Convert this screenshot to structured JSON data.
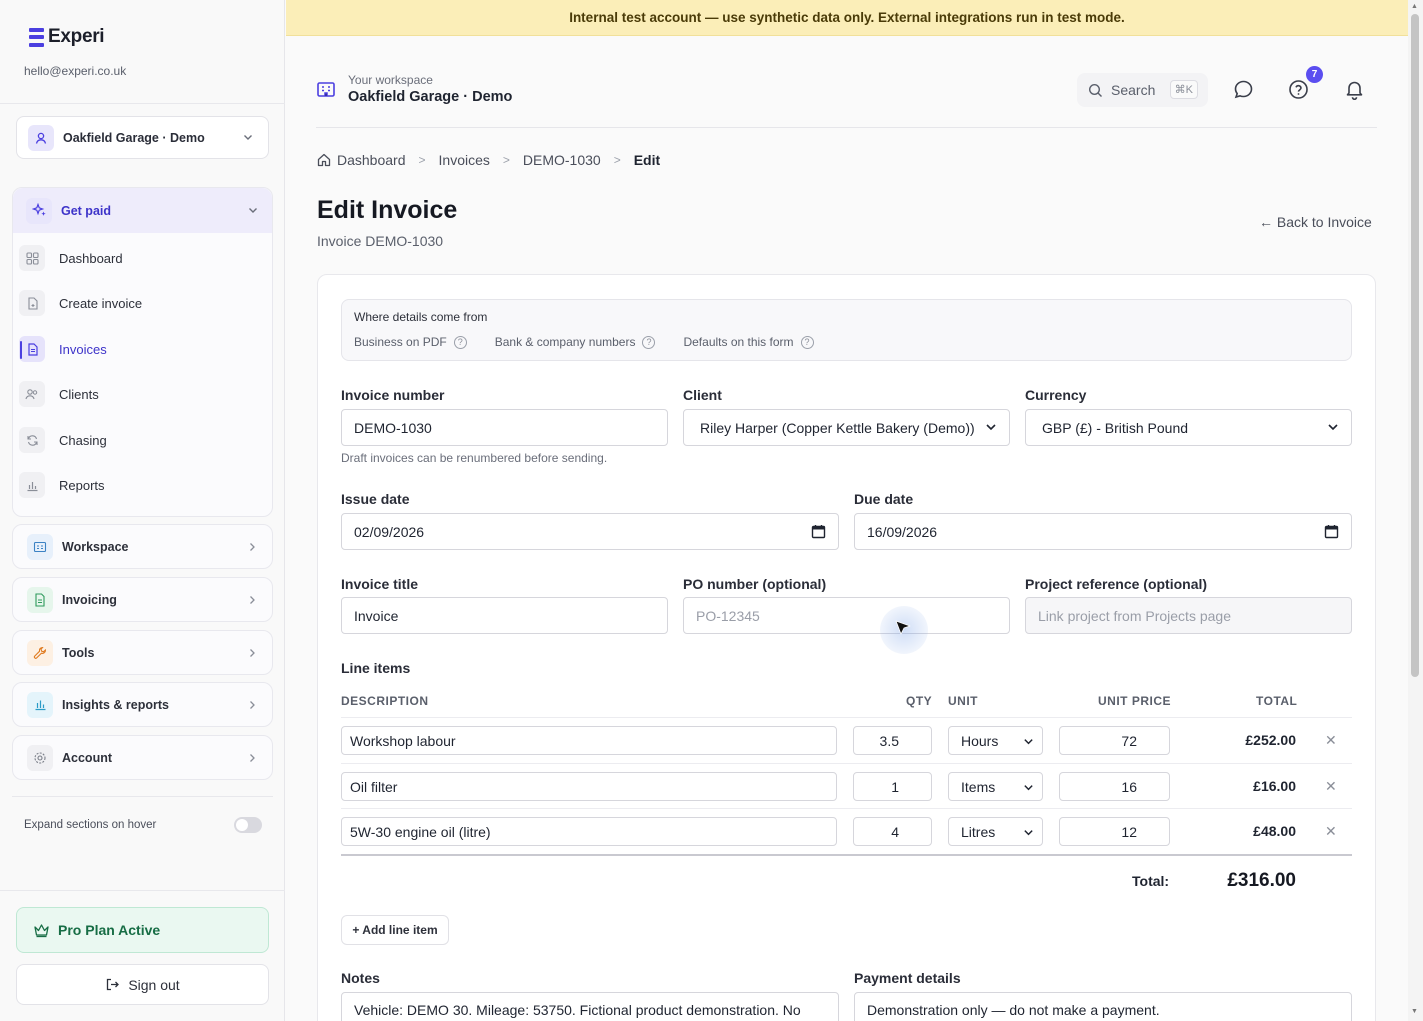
{
  "brand": {
    "name": "Experi",
    "email": "hello@experi.co.uk",
    "accent": "#4b3fe0"
  },
  "workspace_switch": {
    "label": "Oakfield Garage · Demo"
  },
  "sidebar": {
    "open_group": {
      "label": "Get paid",
      "icon": "sparkle-icon"
    },
    "items": [
      {
        "label": "Dashboard",
        "icon": "grid-icon"
      },
      {
        "label": "Create invoice",
        "icon": "file-plus-icon"
      },
      {
        "label": "Invoices",
        "icon": "file-text-icon",
        "active": true
      },
      {
        "label": "Clients",
        "icon": "users-icon"
      },
      {
        "label": "Chasing",
        "icon": "refresh-icon"
      },
      {
        "label": "Reports",
        "icon": "bar-chart-icon"
      }
    ],
    "groups": [
      {
        "label": "Workspace",
        "icon": "building-icon"
      },
      {
        "label": "Invoicing",
        "icon": "document-icon"
      },
      {
        "label": "Tools",
        "icon": "wrench-icon"
      },
      {
        "label": "Insights & reports",
        "icon": "chart-icon"
      },
      {
        "label": "Account",
        "icon": "gear-icon"
      }
    ],
    "hover_toggle_label": "Expand sections on hover",
    "pro_label": "Pro Plan Active",
    "signout_label": "Sign out"
  },
  "banner": {
    "text": "Internal test account — use synthetic data only. External integrations run in test mode.",
    "color": "#fbeeb8"
  },
  "header": {
    "small": "Your workspace",
    "name": "Oakfield Garage · Demo",
    "search_label": "Search",
    "search_kbd": "⌘K",
    "notification_badge": "7"
  },
  "breadcrumb": [
    "Dashboard",
    "Invoices",
    "DEMO-1030",
    "Edit"
  ],
  "page": {
    "title": "Edit Invoice",
    "subtitle": "Invoice DEMO-1030",
    "back_label": "← Back to Invoice"
  },
  "info": {
    "heading": "Where details come from",
    "links": [
      "Business on PDF",
      "Bank & company numbers",
      "Defaults on this form"
    ]
  },
  "form": {
    "invoice_number": {
      "label": "Invoice number",
      "value": "DEMO-1030",
      "hint": "Draft invoices can be renumbered before sending."
    },
    "client": {
      "label": "Client",
      "value": "Riley Harper (Copper Kettle Bakery (Demo))"
    },
    "currency": {
      "label": "Currency",
      "value": "GBP (£) - British Pound"
    },
    "issue_date": {
      "label": "Issue date",
      "value": "02/09/2026"
    },
    "due_date": {
      "label": "Due date",
      "value": "16/09/2026"
    },
    "invoice_title": {
      "label": "Invoice title",
      "value": "Invoice"
    },
    "po_number": {
      "label": "PO number (optional)",
      "placeholder": "PO-12345"
    },
    "project_ref": {
      "label": "Project reference (optional)",
      "placeholder": "Link project from Projects page"
    }
  },
  "line_items": {
    "title": "Line items",
    "headers": {
      "description": "DESCRIPTION",
      "qty": "QTY",
      "unit": "UNIT",
      "unit_price": "UNIT PRICE",
      "total": "TOTAL"
    },
    "rows": [
      {
        "description": "Workshop labour",
        "qty": "3.5",
        "unit": "Hours",
        "unit_price": "72",
        "total": "£252.00"
      },
      {
        "description": "Oil filter",
        "qty": "1",
        "unit": "Items",
        "unit_price": "16",
        "total": "£16.00"
      },
      {
        "description": "5W-30 engine oil (litre)",
        "qty": "4",
        "unit": "Litres",
        "unit_price": "12",
        "total": "£48.00"
      }
    ],
    "total_label": "Total:",
    "total_value": "£316.00",
    "add_label": "+ Add line item"
  },
  "notes": {
    "label": "Notes",
    "value": "Vehicle: DEMO 30. Mileage: 53750. Fictional product demonstration. No"
  },
  "payment": {
    "label": "Payment details",
    "value": "Demonstration only — do not make a payment."
  }
}
